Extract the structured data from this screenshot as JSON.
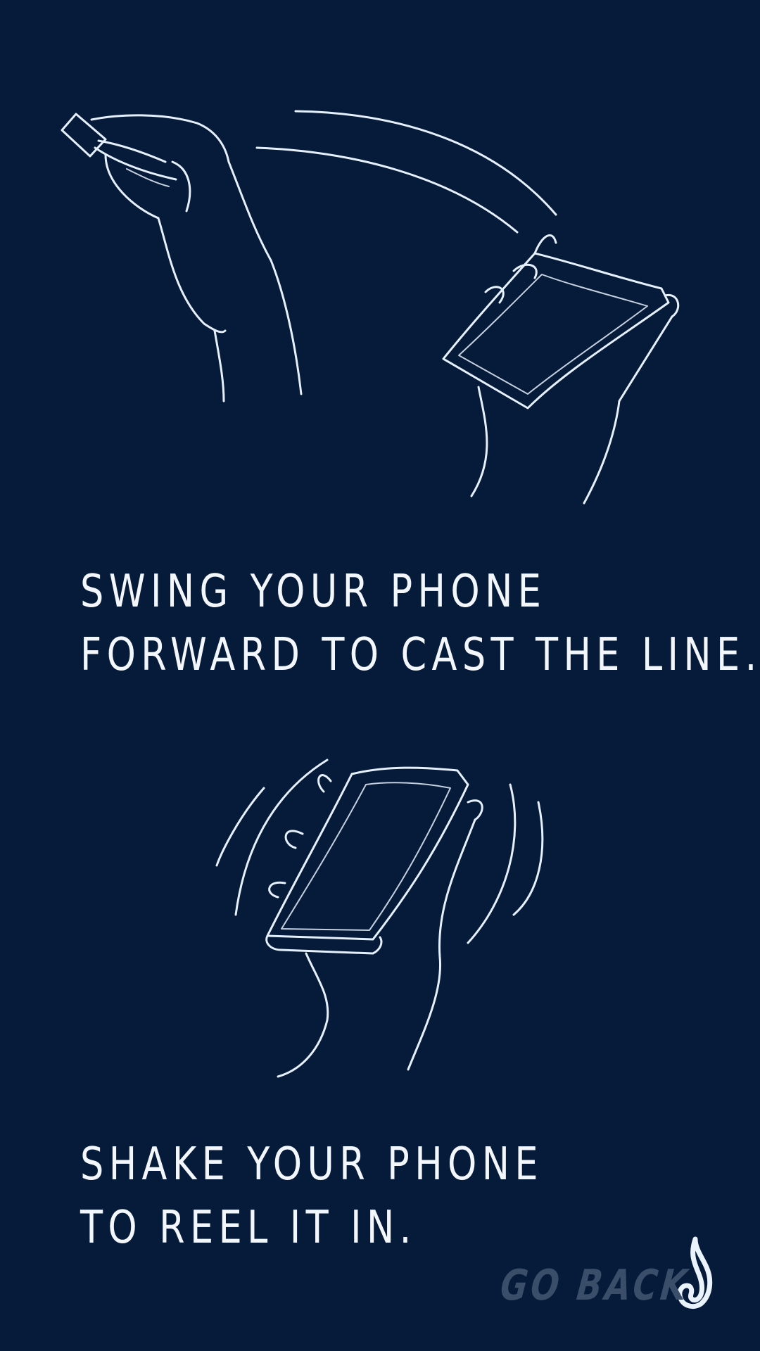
{
  "instructions": {
    "cast": {
      "line1": "SWING YOUR PHONE",
      "line2": "FORWARD TO CAST THE LINE."
    },
    "reel": {
      "line1": "SHAKE YOUR PHONE",
      "line2": "TO REEL IT IN."
    }
  },
  "navigation": {
    "go_back_label": "GO BACK",
    "icon": "fish-hook-icon"
  },
  "colors": {
    "background": "#061b39",
    "text": "#f3f7fc",
    "go_back_text": "#3a4e6a",
    "sketch_line": "#e6f0fb"
  }
}
